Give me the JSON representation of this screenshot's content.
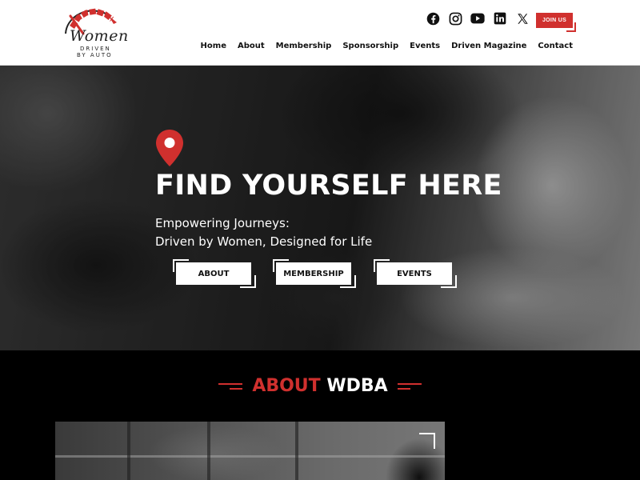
{
  "brand": {
    "logo_word": "Women",
    "logo_line1": "DRIVEN",
    "logo_line2": "BY AUTO",
    "accent_color": "#d0302e"
  },
  "header": {
    "socials": [
      {
        "name": "facebook-icon"
      },
      {
        "name": "instagram-icon"
      },
      {
        "name": "youtube-icon"
      },
      {
        "name": "linkedin-icon"
      },
      {
        "name": "x-twitter-icon"
      }
    ],
    "join_label": "JOIN US",
    "nav": [
      "Home",
      "About",
      "Membership",
      "Sponsorship",
      "Events",
      "Driven Magazine",
      "Contact"
    ]
  },
  "hero": {
    "icon": "location-pin-icon",
    "title": "FIND YOURSELF HERE",
    "subtitle_line1": "Empowering Journeys:",
    "subtitle_line2": "Driven by Women, Designed for Life",
    "buttons": [
      "ABOUT",
      "MEMBERSHIP",
      "EVENTS"
    ]
  },
  "about": {
    "title_part1": "ABOUT",
    "title_part2": "WDBA"
  }
}
